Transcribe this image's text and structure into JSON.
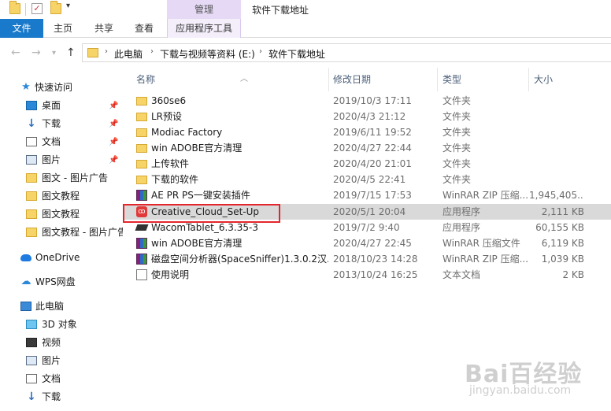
{
  "titlebar": {
    "manage_tab": "管理",
    "window_title": "软件下载地址"
  },
  "ribbon": {
    "tabs": [
      "文件",
      "主页",
      "共享",
      "查看",
      "应用程序工具"
    ]
  },
  "address": {
    "up_arrow": "↑",
    "crumbs": [
      "此电脑",
      "下载与视频等资料 (E:)",
      "软件下载地址"
    ]
  },
  "sidebar": {
    "items": [
      {
        "label": "快速访问",
        "icon": "star-icon"
      },
      {
        "label": "桌面",
        "icon": "desktop-icon",
        "pinned": true
      },
      {
        "label": "下载",
        "icon": "download-icon",
        "pinned": true
      },
      {
        "label": "文档",
        "icon": "document-icon",
        "pinned": true
      },
      {
        "label": "图片",
        "icon": "picture-icon",
        "pinned": true
      },
      {
        "label": "图文 - 图片广告",
        "icon": "folder-icon"
      },
      {
        "label": "图文教程",
        "icon": "folder-icon"
      },
      {
        "label": "图文教程",
        "icon": "folder-icon"
      },
      {
        "label": "图文教程 - 图片广告",
        "icon": "folder-icon"
      },
      {
        "label": "OneDrive",
        "icon": "cloud-icon"
      },
      {
        "label": "WPS网盘",
        "icon": "wps-cloud-icon"
      },
      {
        "label": "此电脑",
        "icon": "computer-icon"
      },
      {
        "label": "3D 对象",
        "icon": "3d-objects-icon"
      },
      {
        "label": "视频",
        "icon": "video-icon"
      },
      {
        "label": "图片",
        "icon": "picture-icon"
      },
      {
        "label": "文档",
        "icon": "document-icon"
      },
      {
        "label": "下载",
        "icon": "download-icon"
      }
    ]
  },
  "filelist": {
    "columns": {
      "name": "名称",
      "date": "修改日期",
      "type": "类型",
      "size": "大小"
    },
    "rows": [
      {
        "name": "360se6",
        "date": "2019/10/3 17:11",
        "type": "文件夹",
        "size": "",
        "icon": "folder"
      },
      {
        "name": "LR预设",
        "date": "2020/4/3 21:12",
        "type": "文件夹",
        "size": "",
        "icon": "folder"
      },
      {
        "name": "Modiac Factory",
        "date": "2019/6/11 19:52",
        "type": "文件夹",
        "size": "",
        "icon": "folder"
      },
      {
        "name": "win ADOBE官方清理",
        "date": "2020/4/27 22:44",
        "type": "文件夹",
        "size": "",
        "icon": "folder"
      },
      {
        "name": "上传软件",
        "date": "2020/4/20 21:01",
        "type": "文件夹",
        "size": "",
        "icon": "folder"
      },
      {
        "name": "下载的软件",
        "date": "2020/4/5 22:41",
        "type": "文件夹",
        "size": "",
        "icon": "folder"
      },
      {
        "name": "AE PR PS一键安装插件",
        "date": "2019/7/15 17:53",
        "type": "WinRAR ZIP 压缩...",
        "size": "1,945,405...",
        "icon": "rar"
      },
      {
        "name": "Creative_Cloud_Set-Up",
        "date": "2020/5/1 20:04",
        "type": "应用程序",
        "size": "2,111 KB",
        "icon": "app",
        "selected": true
      },
      {
        "name": "WacomTablet_6.3.35-3",
        "date": "2019/7/2 9:40",
        "type": "应用程序",
        "size": "60,155 KB",
        "icon": "wacom"
      },
      {
        "name": "win ADOBE官方清理",
        "date": "2020/4/27 22:45",
        "type": "WinRAR 压缩文件",
        "size": "6,119 KB",
        "icon": "rar"
      },
      {
        "name": "磁盘空间分析器(SpaceSniffer)1.3.0.2汉...",
        "date": "2018/10/23 14:28",
        "type": "WinRAR ZIP 压缩...",
        "size": "1,039 KB",
        "icon": "rar"
      },
      {
        "name": "使用说明",
        "date": "2013/10/24 16:25",
        "type": "文本文档",
        "size": "2 KB",
        "icon": "txt"
      }
    ]
  },
  "watermark": {
    "main": "Bai百经验",
    "sub": "jingyan.baidu.com"
  },
  "colors": {
    "file_tab": "#1979ca",
    "manage_tab": "#e5d9f5",
    "selection": "#d9d9d9",
    "highlight": "#e2262c"
  }
}
